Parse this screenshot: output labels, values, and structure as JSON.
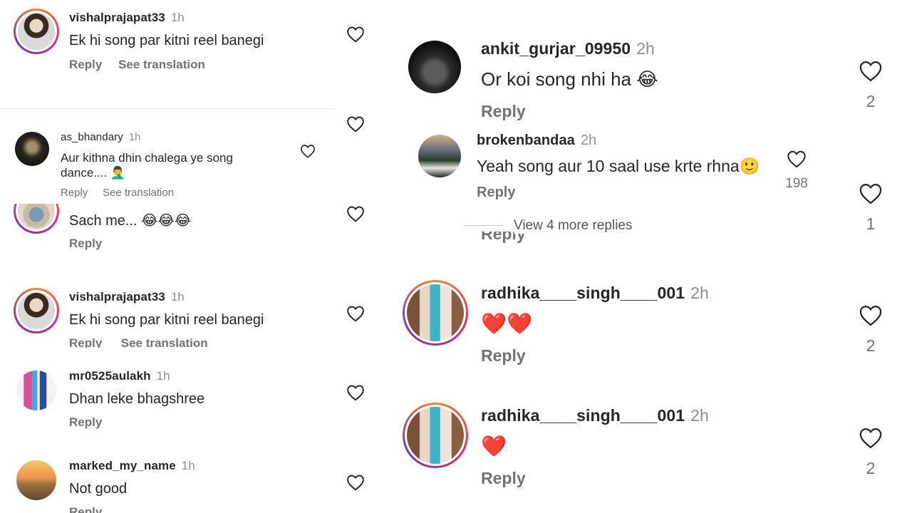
{
  "left": {
    "comments": [
      {
        "username": "vishalprajapat33",
        "time": "1h",
        "text": "Ek hi song par kitni reel banegi",
        "reply": "Reply",
        "translate": "See translation"
      },
      {
        "username": "as_bhandary",
        "time": "1h",
        "text_line1": "Aur kithna  dhin chalega ye song",
        "text_line2": "dance.... 🤦‍♂️",
        "reply": "Reply",
        "translate": "See translation"
      },
      {
        "text": "Sach me... 😂😂😂",
        "reply": "Reply"
      },
      {
        "username": "vishalprajapat33",
        "time": "1h",
        "text": "Ek hi song par kitni reel banegi",
        "reply": "Reply",
        "translate": "See translation"
      },
      {
        "username": "mr0525aulakh",
        "time": "1h",
        "text": "Dhan leke bhagshree",
        "reply": "Reply"
      },
      {
        "username": "marked_my_name",
        "time": "1h",
        "text": "Not good",
        "reply": "Reply"
      }
    ]
  },
  "right": {
    "comments": [
      {
        "username": "ankit_gurjar_09950",
        "time": "2h",
        "text": "Or koi song nhi ha 😂",
        "reply": "Reply",
        "likes": "2"
      },
      {
        "username": "brokenbandaa",
        "time": "2h",
        "text": "Yeah song aur 10 saal use krte rhna🙂",
        "reply": "Reply",
        "likes": "198"
      },
      {
        "likes": "1",
        "view_more": "View 4 more replies",
        "reply_partial": "Reply"
      },
      {
        "username": "radhika____singh____001",
        "time": "2h",
        "text": "❤️❤️",
        "reply": "Reply",
        "likes": "2"
      },
      {
        "username": "radhika____singh____001",
        "time": "2h",
        "text": "❤️",
        "reply": "Reply",
        "likes": "2"
      }
    ]
  },
  "icons": {
    "like": "heart-outline-icon"
  },
  "colors": {
    "text": "#262626",
    "muted": "#737373",
    "time": "#8e8e8e"
  }
}
